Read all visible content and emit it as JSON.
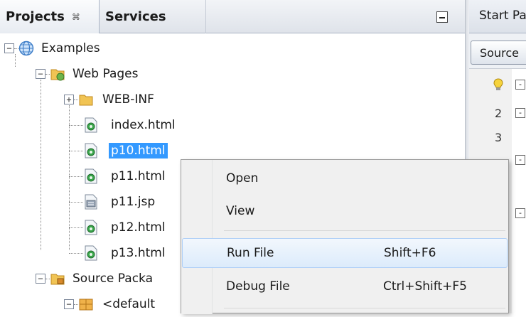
{
  "tabs": {
    "projects": "Projects",
    "services": "Services",
    "close_glyph": "⌘"
  },
  "editor": {
    "tab_label": "Start Pa",
    "source_button": "Source",
    "line_numbers": [
      "2",
      "3"
    ]
  },
  "tree": {
    "examples": "Examples",
    "web_pages": "Web Pages",
    "web_inf": "WEB-INF",
    "files": [
      "index.html",
      "p10.html",
      "p11.html",
      "p11.jsp",
      "p12.html",
      "p13.html"
    ],
    "source_packages": "Source Packa",
    "default_package": "<default"
  },
  "context_menu": {
    "open": "Open",
    "view": "View",
    "run_file": "Run File",
    "run_file_accel": "Shift+F6",
    "debug_file": "Debug File",
    "debug_file_accel": "Ctrl+Shift+F5"
  },
  "colors": {
    "selection": "#3399ff",
    "menu_bg": "#f0f0f0",
    "hover_border": "#aecff7"
  }
}
